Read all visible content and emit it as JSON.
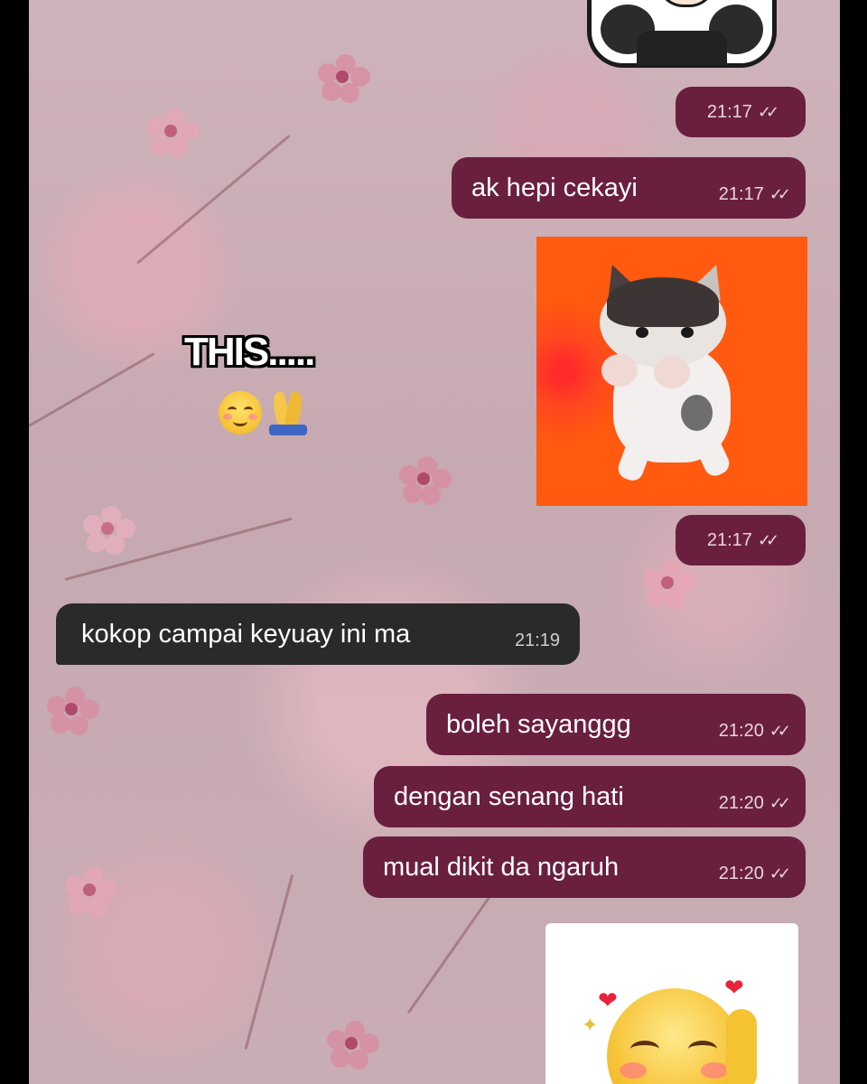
{
  "chat": {
    "messages": [
      {
        "id": "m1",
        "direction": "outgoing",
        "type": "time_only",
        "time": "21:17",
        "status_icon": "double-check"
      },
      {
        "id": "m2",
        "direction": "outgoing",
        "type": "text",
        "text": "ak hepi cekayi",
        "time": "21:17",
        "status_icon": "double-check"
      },
      {
        "id": "m3",
        "direction": "outgoing",
        "type": "sticker",
        "sticker": "dancing-kitten-orange-background",
        "time": "21:17",
        "status_icon": "double-check"
      },
      {
        "id": "m4",
        "direction": "incoming",
        "type": "text",
        "text": "kokop campai keyuay ini ma",
        "time": "21:19"
      },
      {
        "id": "m5",
        "direction": "outgoing",
        "type": "text",
        "text": "boleh sayanggg",
        "time": "21:20",
        "status_icon": "double-check"
      },
      {
        "id": "m6",
        "direction": "outgoing",
        "type": "text",
        "text": "dengan senang hati",
        "time": "21:20",
        "status_icon": "double-check"
      },
      {
        "id": "m7",
        "direction": "outgoing",
        "type": "text",
        "text": "mual dikit da ngaruh",
        "time": "21:20",
        "status_icon": "double-check"
      },
      {
        "id": "m8",
        "direction": "outgoing",
        "type": "sticker",
        "sticker": "smiling-blush-emoji-with-hearts"
      }
    ]
  },
  "overlay": {
    "caption": "THIS.....",
    "emojis": [
      "smiling-face-icon",
      "folded-hands-icon"
    ]
  },
  "theme": {
    "outgoing_bubble": "#6b1f3e",
    "incoming_bubble": "#2a2a2a",
    "wallpaper": "pink-floral"
  }
}
